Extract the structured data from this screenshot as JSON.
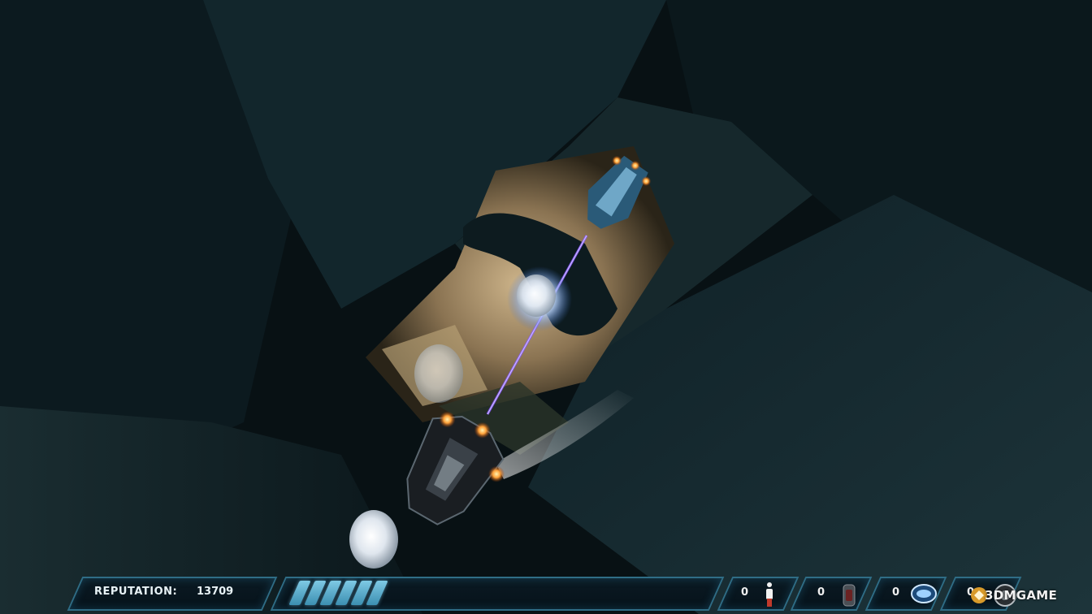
{
  "hud": {
    "reputation_label": "REPUTATION:",
    "reputation_value": "13709",
    "energy_segments": 6,
    "inventory": [
      {
        "icon": "person-figure-icon",
        "count": "0"
      },
      {
        "icon": "canister-icon",
        "count": "0"
      },
      {
        "icon": "shield-orb-icon",
        "count": "0"
      },
      {
        "icon": "wheel-icon",
        "count": "0"
      }
    ]
  },
  "watermark": {
    "text": "3DMGAME"
  },
  "colors": {
    "hud_border": "#2f6d86",
    "hud_fill": "#0b1a23",
    "energy_bar": "#7ec9e4",
    "laser": "#8a5cff",
    "engine_glow": "#ff9a2a"
  }
}
